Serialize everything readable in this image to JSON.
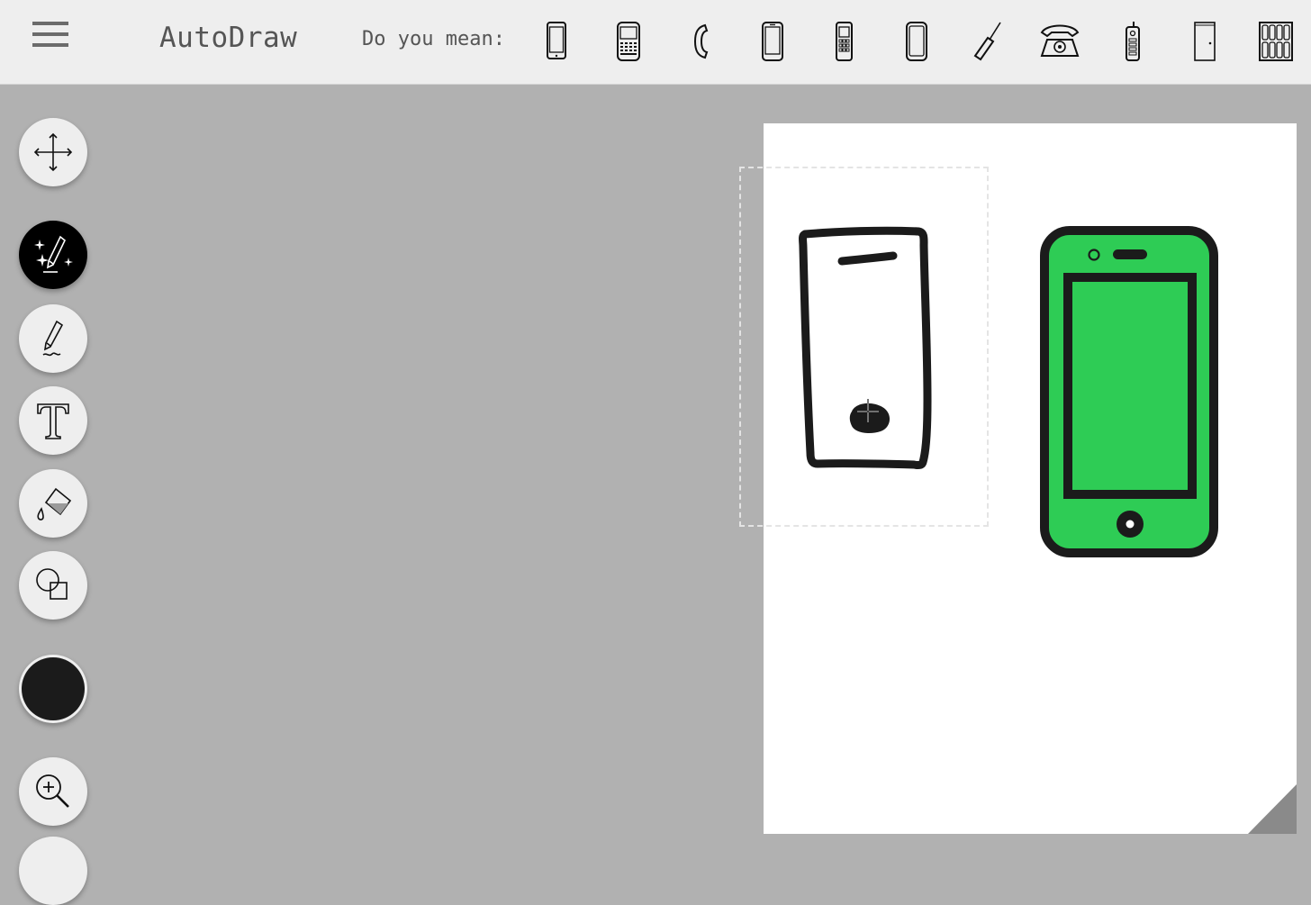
{
  "app": {
    "title": "AutoDraw"
  },
  "suggestions": {
    "prompt": "Do you mean:",
    "items": [
      {
        "icon": "smartphone-icon"
      },
      {
        "icon": "qwerty-phone-icon"
      },
      {
        "icon": "phone-handset-icon"
      },
      {
        "icon": "smartphone-icon"
      },
      {
        "icon": "keypad-phone-icon"
      },
      {
        "icon": "smartphone-icon"
      },
      {
        "icon": "toothbrush-icon"
      },
      {
        "icon": "rotary-telephone-icon"
      },
      {
        "icon": "walkie-talkie-icon"
      },
      {
        "icon": "door-icon"
      },
      {
        "icon": "keyboard-grid-icon"
      }
    ]
  },
  "toolbar": {
    "tools": [
      {
        "name": "move-tool",
        "icon": "move-icon"
      },
      {
        "name": "autodraw-tool",
        "icon": "autodraw-icon",
        "active": true
      },
      {
        "name": "draw-tool",
        "icon": "pencil-icon"
      },
      {
        "name": "text-tool",
        "icon": "text-icon"
      },
      {
        "name": "fill-tool",
        "icon": "paint-bucket-icon"
      },
      {
        "name": "shape-tool",
        "icon": "shapes-icon"
      }
    ],
    "current_color": "#1b1b1b",
    "zoom_icon": "zoom-in-icon"
  },
  "canvas": {
    "background": "#ffffff",
    "sketch": "hand-drawn-phone-outline",
    "suggested_drawing": "smartphone-illustration",
    "accent_color": "#2ecc55"
  }
}
